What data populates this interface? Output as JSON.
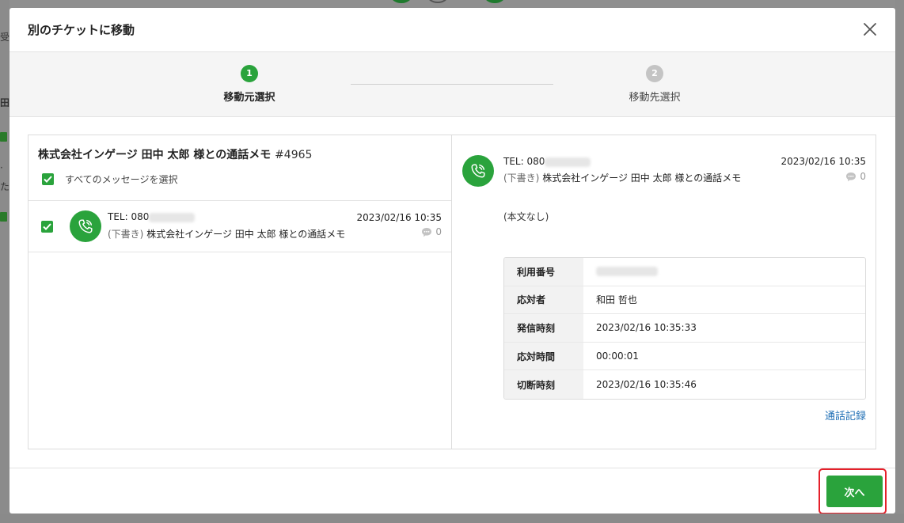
{
  "background": {
    "left_fragments": [
      "受",
      "田",
      "·",
      "た"
    ]
  },
  "modal": {
    "title": "別のチケットに移動",
    "close_icon": "close-icon"
  },
  "stepper": {
    "steps": [
      {
        "number": "1",
        "label": "移動元選択",
        "state": "active"
      },
      {
        "number": "2",
        "label": "移動先選択",
        "state": "inactive"
      }
    ]
  },
  "left_pane": {
    "ticket_title": "株式会社インゲージ 田中 太郎 様との通話メモ",
    "ticket_number": "#4965",
    "select_all_label": "すべてのメッセージを選択",
    "select_all_checked": true,
    "messages": [
      {
        "checked": true,
        "tel_label": "TEL: 080",
        "draft_tag": "(下書き)",
        "subject": "株式会社インゲージ 田中 太郎 様との通話メモ",
        "date": "2023/02/16 10:35",
        "comment_count": "0"
      }
    ]
  },
  "right_pane": {
    "tel_label": "TEL: 080",
    "draft_tag": "(下書き)",
    "subject": "株式会社インゲージ 田中 太郎 様との通話メモ",
    "date": "2023/02/16 10:35",
    "comment_count": "0",
    "body": "(本文なし)",
    "info": [
      {
        "key": "利用番号",
        "value": ""
      },
      {
        "key": "応対者",
        "value": "和田 哲也"
      },
      {
        "key": "発信時刻",
        "value": "2023/02/16 10:35:33"
      },
      {
        "key": "応対時間",
        "value": "00:00:01"
      },
      {
        "key": "切断時刻",
        "value": "2023/02/16 10:35:46"
      }
    ],
    "call_log_link": "通話記録"
  },
  "footer": {
    "next_label": "次へ"
  },
  "colors": {
    "accent": "#2aa33c",
    "link": "#1f6fb5",
    "highlight": "#e5202a"
  }
}
